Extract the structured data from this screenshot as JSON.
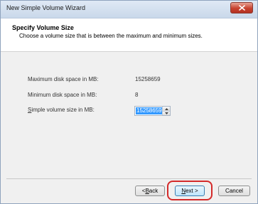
{
  "window": {
    "title": "New Simple Volume Wizard",
    "close_icon": "close-icon"
  },
  "header": {
    "title": "Specify Volume Size",
    "subtitle": "Choose a volume size that is between the maximum and minimum sizes."
  },
  "fields": {
    "max_label": "Maximum disk space in MB:",
    "max_value": "15258659",
    "min_label": "Minimum disk space in MB:",
    "min_value": "8",
    "size_label_prefix": "S",
    "size_label_rest": "imple volume size in MB:",
    "size_value": "15258659"
  },
  "buttons": {
    "back_prefix": "< ",
    "back_mnemonic": "B",
    "back_rest": "ack",
    "next_mnemonic": "N",
    "next_rest": "ext >",
    "cancel_label": "Cancel"
  },
  "colors": {
    "highlight": "#d42a2a",
    "selection": "#3399ff"
  }
}
